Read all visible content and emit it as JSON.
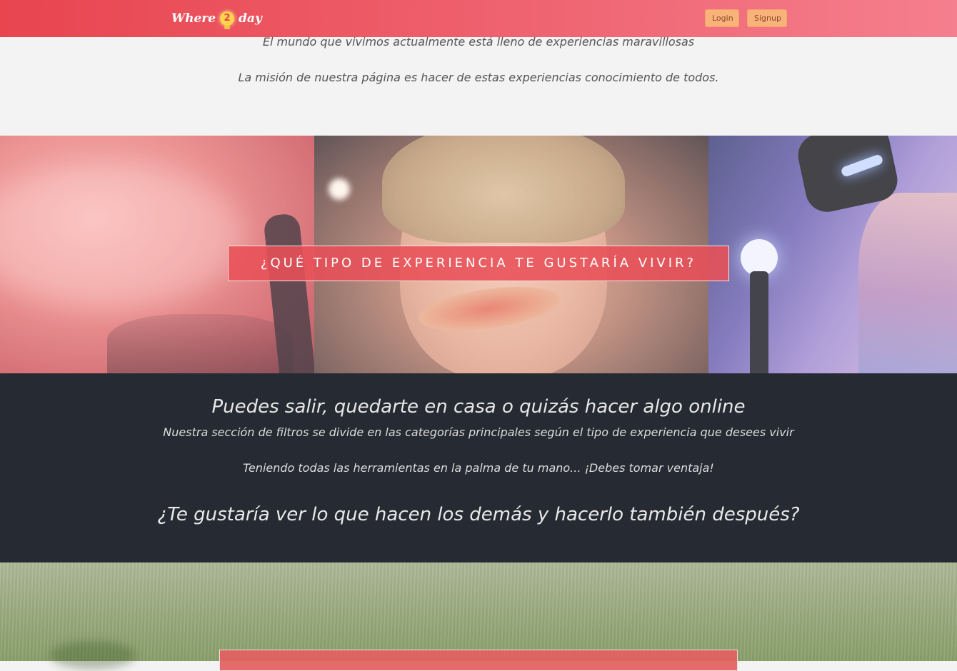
{
  "header": {
    "logo_left": "Where",
    "logo_num": "2",
    "logo_right": "day",
    "login_label": "Login",
    "signup_label": "Signup"
  },
  "intro": {
    "line1": "El mundo que vivimos actualmente está lleno de experiencias maravillosas",
    "line2": "La misión de nuestra página es hacer de estas experiencias conocimiento de todos."
  },
  "banner": {
    "cta": "¿QUÉ TIPO DE EXPERIENCIA TE GUSTARÍA VIVIR?"
  },
  "dark_section": {
    "heading": "Puedes salir, quedarte en casa o quizás hacer algo online",
    "text1": "Nuestra sección de filtros se divide en las categorías principales según el tipo de experiencia que desees vivir",
    "text2": "Teniendo todas las herramientas en la palma de tu mano... ¡Debes tomar ventaja!",
    "question": "¿Te gustaría ver lo que hacen los demás y hacerlo también después?"
  },
  "grass_section": {
    "cta": ""
  },
  "colors": {
    "header_start": "#e8454f",
    "header_end": "#f57f8e",
    "button_bg": "#f8b27a",
    "cta_bg": "#e85058",
    "dark_bg": "#262a32",
    "light_bg": "#f3f3f3"
  }
}
